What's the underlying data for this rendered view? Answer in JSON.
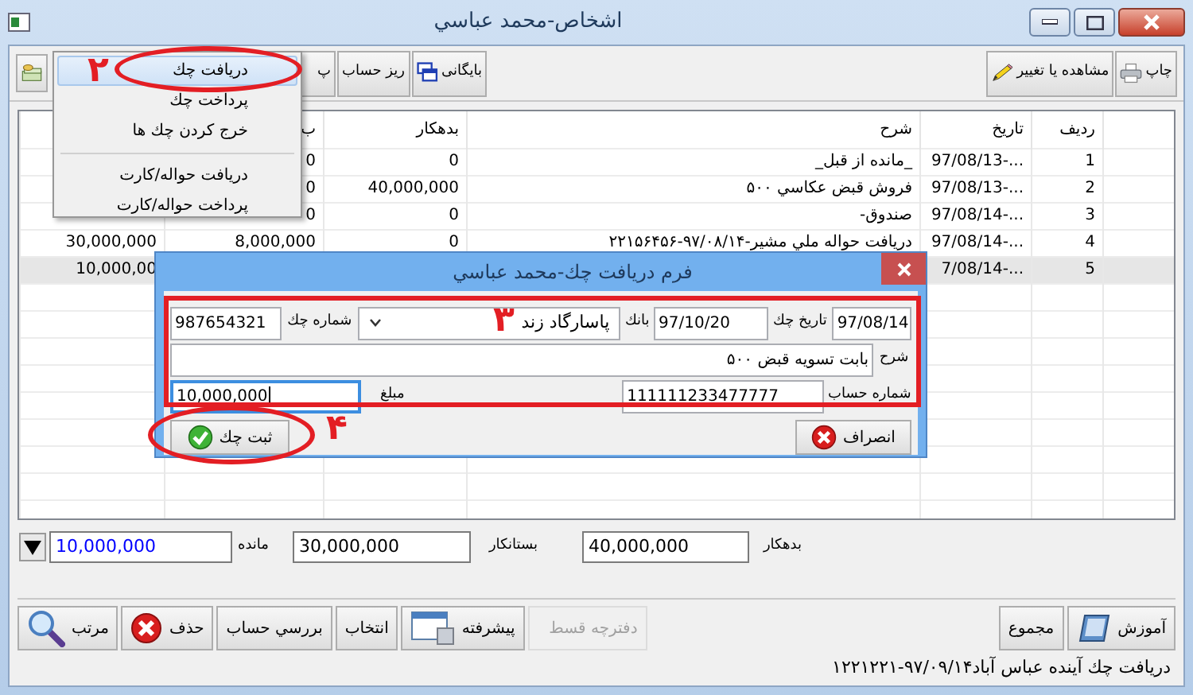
{
  "window": {
    "title": "اشخاص-محمد عباسي"
  },
  "toolbar": {
    "right_buttons": [
      {
        "label": "چاپ",
        "kind": "print"
      },
      {
        "label": "مشاهده یا تغییر",
        "kind": "edit"
      }
    ],
    "left_buttons": [
      {
        "label": "بایگانی",
        "kind": "archive"
      },
      {
        "label": "ریز حساب",
        "kind": "plain"
      },
      {
        "label": "پ",
        "kind": "plain"
      },
      {
        "kind": "money"
      }
    ]
  },
  "menu": {
    "groups": [
      [
        {
          "label": "دریافت چك",
          "selected": true
        },
        {
          "label": "پرداخت چك",
          "selected": false
        },
        {
          "label": "خرج کردن چك ها",
          "selected": false
        }
      ],
      [
        {
          "label": "دریافت حواله/کارت",
          "selected": false
        },
        {
          "label": "پرداخت حواله/کارت",
          "selected": false
        }
      ]
    ]
  },
  "table": {
    "columns": [
      "ردیف",
      "تاریخ",
      "شرح",
      "بدهکار",
      "ب"
    ],
    "rows": [
      {
        "number": "1",
        "date": "97/08/13-...",
        "description": "_مانده از قبل_",
        "debit": "0",
        "credit": "0",
        "selected": false
      },
      {
        "number": "2",
        "date": "97/08/13-...",
        "description": "فروش قبض عکاسي ۵۰۰",
        "debit": "40,000,000",
        "credit": "0",
        "selected": false
      },
      {
        "number": "3",
        "date": "97/08/14-...",
        "description": "صندوق-",
        "debit": "0",
        "credit": "0",
        "selected": false
      },
      {
        "number": "4",
        "date": "97/08/14-...",
        "description": "دریافت حواله ملي مشیر-۹۷/۰۸/۱۴-۲۲۱۵۶۴۵۶",
        "debit": "0",
        "credit": "8,000,000",
        "balance": "30,000,000",
        "selected": false
      },
      {
        "number": "5",
        "date": "7/08/14-...",
        "balance": "10,000,00",
        "selected": true
      }
    ]
  },
  "totals": [
    {
      "label": "بدهکار",
      "value": "40,000,000",
      "color": "#000000"
    },
    {
      "label": "بستانکار",
      "value": "30,000,000",
      "color": "#000000"
    },
    {
      "label": "مانده",
      "value": "10,000,000",
      "color": "#0000ff"
    }
  ],
  "bottom_bar": {
    "right_buttons": [
      {
        "label": "آموزش",
        "kind": "help",
        "disabled": false
      },
      {
        "label": "مجموع",
        "kind": "plain",
        "disabled": false
      }
    ],
    "left_buttons": [
      {
        "label": "دفترچه قسط",
        "kind": "plain",
        "disabled": true
      },
      {
        "label": "پیشرفته",
        "kind": "window",
        "disabled": false
      },
      {
        "label": "انتخاب",
        "kind": "plain",
        "disabled": false
      },
      {
        "label": "بررسي حساب",
        "kind": "plain",
        "disabled": false
      },
      {
        "label": "حذف",
        "kind": "delete",
        "disabled": false
      },
      {
        "label": "مرتب",
        "kind": "search",
        "disabled": false
      }
    ]
  },
  "status_bar": "دریافت چك آینده عباس آباد۹۷/۰۹/۱۴-۱۲۲۱۲۲۱",
  "dialog": {
    "title": "فرم دریافت چك-محمد عباسي",
    "fields": [
      {
        "kind": "text",
        "value": "97/08/14",
        "focused": false
      },
      {
        "kind": "text",
        "label": "تاریخ چك",
        "value": "97/10/20",
        "focused": false
      },
      {
        "kind": "combo",
        "label": "بانك",
        "value": "پاسارگاد زند"
      },
      {
        "kind": "text",
        "label": "شماره چك",
        "value": "987654321",
        "focused": false
      },
      {
        "kind": "text",
        "label": "شرح",
        "value": "بابت تسویه قبض ۵۰۰",
        "focused": false
      },
      {
        "kind": "text",
        "label": "شماره حساب",
        "value": "111111233477777",
        "focused": false
      },
      {
        "kind": "text",
        "label": "مبلغ",
        "value": "10,000,000",
        "focused": true
      }
    ],
    "buttons": [
      {
        "label": "انصراف",
        "kind": "cancel"
      },
      {
        "label": "ثبت چك",
        "kind": "ok"
      }
    ]
  },
  "annotations": [
    {
      "label": "۲",
      "kind": "ellipse"
    },
    {
      "label": "۳",
      "kind": "rect"
    },
    {
      "label": "۴",
      "kind": "ellipse"
    }
  ]
}
